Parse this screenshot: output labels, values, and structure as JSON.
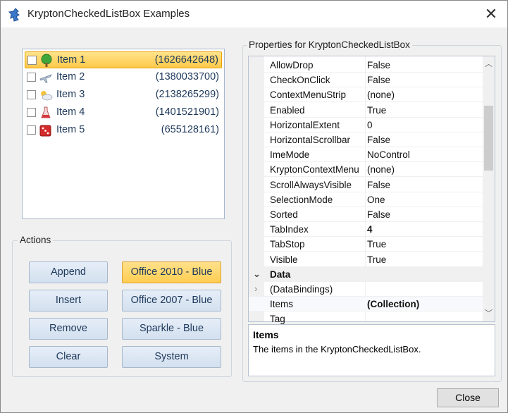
{
  "window": {
    "title": "KryptonCheckedListBox Examples",
    "close_glyph": "✕",
    "icon": "krypton-app-icon"
  },
  "listbox": {
    "items": [
      {
        "label": "Item 1",
        "value": "(1626642648)",
        "checked": false,
        "selected": true,
        "icon": "tree-icon"
      },
      {
        "label": "Item 2",
        "value": "(1380033700)",
        "checked": false,
        "selected": false,
        "icon": "airplane-icon"
      },
      {
        "label": "Item 3",
        "value": "(2138265299)",
        "checked": false,
        "selected": false,
        "icon": "cloud-sun-icon"
      },
      {
        "label": "Item 4",
        "value": "(1401521901)",
        "checked": false,
        "selected": false,
        "icon": "flask-icon"
      },
      {
        "label": "Item 5",
        "value": "(655128161)",
        "checked": false,
        "selected": false,
        "icon": "dice-icon"
      }
    ]
  },
  "actions": {
    "title": "Actions",
    "buttons": [
      "Append",
      "Insert",
      "Remove",
      "Clear"
    ],
    "palettes": [
      "Office 2010 - Blue",
      "Office 2007 - Blue",
      "Sparkle - Blue",
      "System"
    ],
    "active_palette": "Office 2010 - Blue"
  },
  "properties": {
    "title": "Properties for KryptonCheckedListBox",
    "rows": [
      {
        "name": "AllowDrop",
        "value": "False"
      },
      {
        "name": "CheckOnClick",
        "value": "False"
      },
      {
        "name": "ContextMenuStrip",
        "value": "(none)"
      },
      {
        "name": "Enabled",
        "value": "True"
      },
      {
        "name": "HorizontalExtent",
        "value": "0"
      },
      {
        "name": "HorizontalScrollbar",
        "value": "False"
      },
      {
        "name": "ImeMode",
        "value": "NoControl"
      },
      {
        "name": "KryptonContextMenu",
        "value": "(none)"
      },
      {
        "name": "ScrollAlwaysVisible",
        "value": "False"
      },
      {
        "name": "SelectionMode",
        "value": "One"
      },
      {
        "name": "Sorted",
        "value": "False"
      },
      {
        "name": "TabIndex",
        "value": "4",
        "bold": true
      },
      {
        "name": "TabStop",
        "value": "True"
      },
      {
        "name": "Visible",
        "value": "True"
      },
      {
        "name": "Data",
        "value": "",
        "category": true
      },
      {
        "name": "(DataBindings)",
        "value": "",
        "expandable": true
      },
      {
        "name": "Items",
        "value": "(Collection)",
        "bold": true
      },
      {
        "name": "Tag",
        "value": ""
      }
    ],
    "help_title": "Items",
    "help_description": "The items in the KryptonCheckedListBox."
  },
  "footer": {
    "close_label": "Close"
  },
  "colors": {
    "accent": "#ffc94a",
    "button": "#dbe6f3",
    "text": "#1e395b"
  }
}
